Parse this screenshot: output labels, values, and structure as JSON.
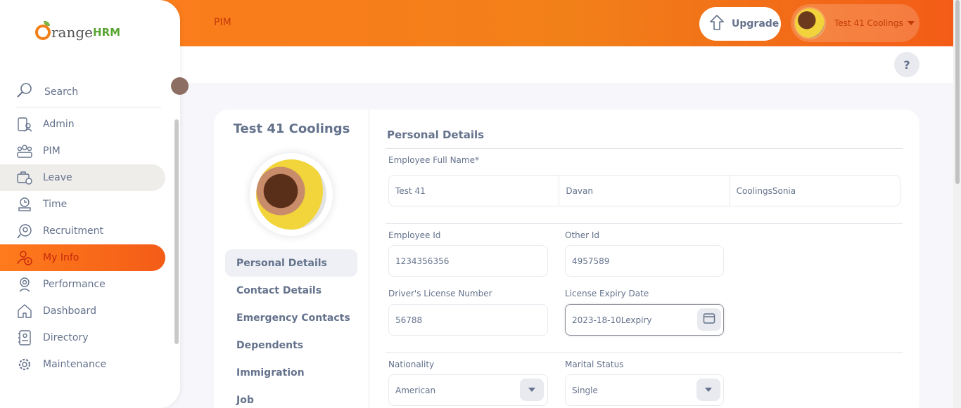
{
  "header": {
    "module": "PIM",
    "upgrade_label": "Upgrade",
    "user_name": "Test 41 Coolings",
    "help": "?"
  },
  "brand": {
    "orange": "range",
    "hrm": "HRM"
  },
  "sidebar": {
    "search_label": "Search",
    "items": [
      {
        "label": "Admin",
        "icon": "admin-icon"
      },
      {
        "label": "PIM",
        "icon": "pim-icon"
      },
      {
        "label": "Leave",
        "icon": "leave-icon"
      },
      {
        "label": "Time",
        "icon": "time-icon"
      },
      {
        "label": "Recruitment",
        "icon": "recruitment-icon"
      },
      {
        "label": "My Info",
        "icon": "myinfo-icon"
      },
      {
        "label": "Performance",
        "icon": "performance-icon"
      },
      {
        "label": "Dashboard",
        "icon": "dashboard-icon"
      },
      {
        "label": "Directory",
        "icon": "directory-icon"
      },
      {
        "label": "Maintenance",
        "icon": "maintenance-icon"
      }
    ],
    "hovered": "Leave",
    "active": "My Info"
  },
  "profile": {
    "name": "Test 41 Coolings",
    "tabs": [
      "Personal Details",
      "Contact Details",
      "Emergency Contacts",
      "Dependents",
      "Immigration",
      "Job"
    ],
    "active_tab": "Personal Details"
  },
  "form": {
    "section_title": "Personal Details",
    "full_name_label": "Employee Full Name*",
    "first_name": "Test 41",
    "middle_name": "Davan",
    "last_name": "CoolingsSonia",
    "employee_id_label": "Employee Id",
    "employee_id": "1234356356",
    "other_id_label": "Other Id",
    "other_id": "4957589",
    "license_label": "Driver's License Number",
    "license": "56788",
    "license_expiry_label": "License Expiry Date",
    "license_expiry": "2023-18-10Lexpiry",
    "nationality_label": "Nationality",
    "nationality": "American",
    "marital_label": "Marital Status",
    "marital": "Single"
  },
  "colors": {
    "accent": "#ff7b1d",
    "accent_dark": "#f35c17",
    "text": "#64728c"
  }
}
